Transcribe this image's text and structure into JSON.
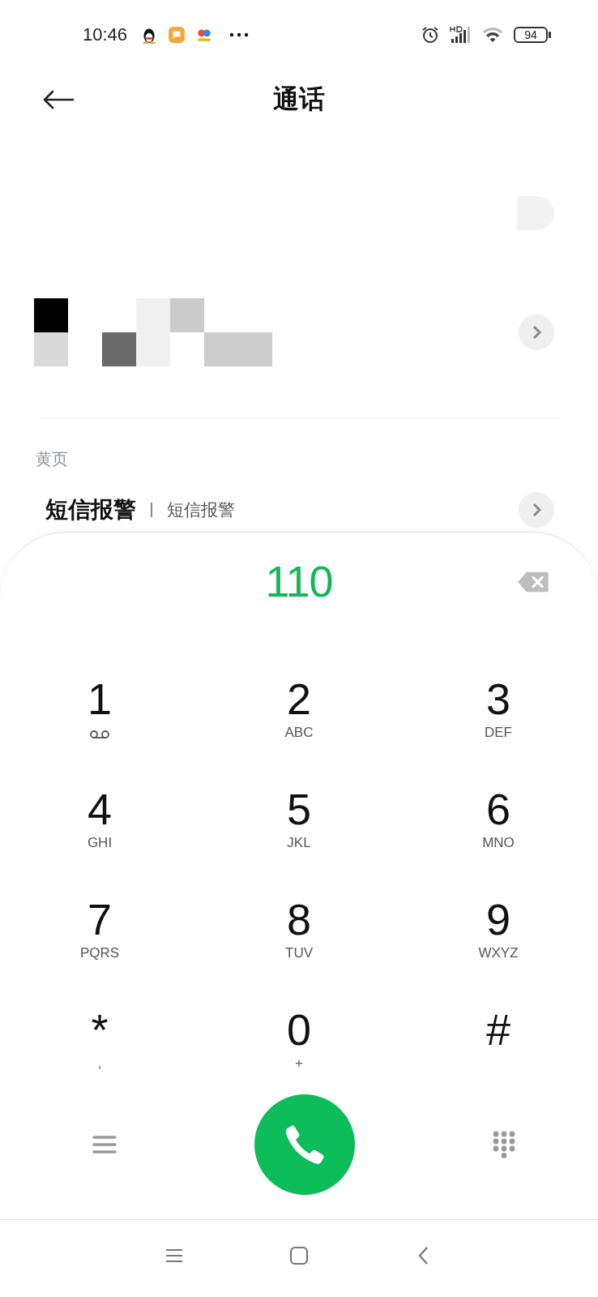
{
  "status_bar": {
    "time": "10:46",
    "battery": "94"
  },
  "header": {
    "title": "通话"
  },
  "yellow_pages": {
    "heading": "黄页",
    "entry": {
      "name": "短信报警",
      "detail": "短信报警"
    }
  },
  "dialer": {
    "number": "110",
    "keys": [
      {
        "digit": "1",
        "kind": "voicemail"
      },
      {
        "digit": "2",
        "letters": "ABC",
        "kind": "letters"
      },
      {
        "digit": "3",
        "letters": "DEF",
        "kind": "letters"
      },
      {
        "digit": "4",
        "letters": "GHI",
        "kind": "letters"
      },
      {
        "digit": "5",
        "letters": "JKL",
        "kind": "letters"
      },
      {
        "digit": "6",
        "letters": "MNO",
        "kind": "letters"
      },
      {
        "digit": "7",
        "letters": "PQRS",
        "kind": "letters"
      },
      {
        "digit": "8",
        "letters": "TUV",
        "kind": "letters"
      },
      {
        "digit": "9",
        "letters": "WXYZ",
        "kind": "letters"
      },
      {
        "digit": "*",
        "letters": ",",
        "kind": "letters"
      },
      {
        "digit": "0",
        "letters": "+",
        "kind": "letters"
      },
      {
        "digit": "#",
        "kind": "plain"
      }
    ]
  }
}
